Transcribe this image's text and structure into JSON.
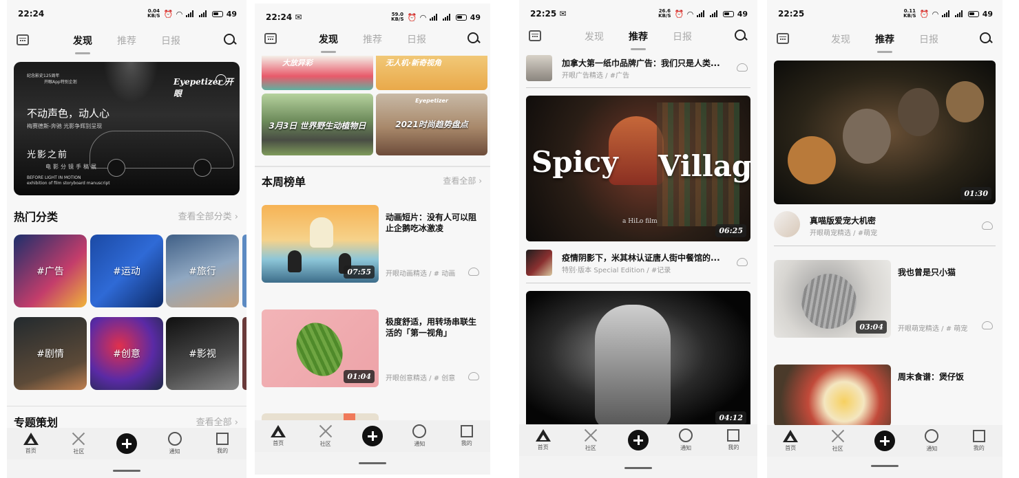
{
  "status": {
    "p1": {
      "time": "22:24",
      "speed_top": "0.04",
      "speed_bot": "KB/S",
      "battery": "49"
    },
    "p2": {
      "time": "22:24",
      "speed_top": "59.0",
      "speed_bot": "KB/S",
      "battery": "49"
    },
    "p3": {
      "time": "22:25",
      "speed_top": "26.6",
      "speed_bot": "KB/S",
      "battery": "49"
    },
    "p4": {
      "time": "22:25",
      "speed_top": "0.11",
      "speed_bot": "KB/S",
      "battery": "49"
    }
  },
  "tabs": {
    "discover": "发现",
    "recommend": "推荐",
    "daily": "日报"
  },
  "bottom_nav": {
    "home": "首页",
    "community": "社区",
    "notify": "通知",
    "mine": "我的"
  },
  "p1": {
    "banner": {
      "small1": "纪念影史125周年",
      "small2": "开眼App特别企划",
      "title": "不动声色，动人心",
      "subtitle": "梅赛德斯-奔驰 光影争辉别呈现",
      "title2": "光影之前",
      "title3": "电影分镜手稿展",
      "small3": "BEFORE LIGHT IN MOTION",
      "small4": "exhibition of film storyboard manuscript",
      "logo": "Eyepetizer 开眼"
    },
    "hot_title": "热门分类",
    "hot_see_all": "查看全部分类",
    "categories": [
      "#广告",
      "#运动",
      "#旅行",
      "#剧情",
      "#创意",
      "#影视"
    ],
    "special_title": "专题策划",
    "special_see_all": "查看全部"
  },
  "p2": {
    "top_cards": [
      {
        "text": "3月3日 世界野生动植物日"
      },
      {
        "text": "2021时尚趋势盘点"
      }
    ],
    "partial_top": [
      "大放异彩",
      "无人机·新奇视角"
    ],
    "logo_small": "Eyepetizer",
    "weekly_title": "本周榜单",
    "weekly_see_all": "查看全部",
    "items": [
      {
        "title": "动画短片：没有人可以阻止企鹅吃冰激凌",
        "meta": "开眼动画精选 / # 动画",
        "duration": "07:55"
      },
      {
        "title": "极度舒适，用转场串联生活的「第一视角」",
        "meta": "开眼创意精选 / # 创意",
        "duration": "01:04"
      }
    ]
  },
  "p3": {
    "row1": {
      "title": "加拿大第一纸巾品牌广告：我们只是人类...",
      "meta": "开眼广告精选 / #广告"
    },
    "video1": {
      "overlay_left": "Spicy",
      "overlay_right": "Village",
      "small": "a HiLo film",
      "duration": "06:25"
    },
    "row2": {
      "title": "疫情阴影下，米其林认证唐人街中餐馆的...",
      "meta": "特别·版本 Special Edition / #记录"
    },
    "video2": {
      "duration": "04:12"
    }
  },
  "p4": {
    "video1": {
      "duration": "01:30"
    },
    "row1": {
      "title": "真喵版爱宠大机密",
      "meta": "开眼萌宠精选 / #萌宠"
    },
    "items": [
      {
        "title": "我也曾是只小猫",
        "meta": "开眼萌宠精选 / # 萌宠",
        "duration": "03:04"
      },
      {
        "title": "周末食谱：煲仔饭",
        "meta": "",
        "duration": ""
      }
    ]
  },
  "colors": {
    "accent": "#111111",
    "muted": "#aaaaaa",
    "bg": "#f7f7f7"
  }
}
